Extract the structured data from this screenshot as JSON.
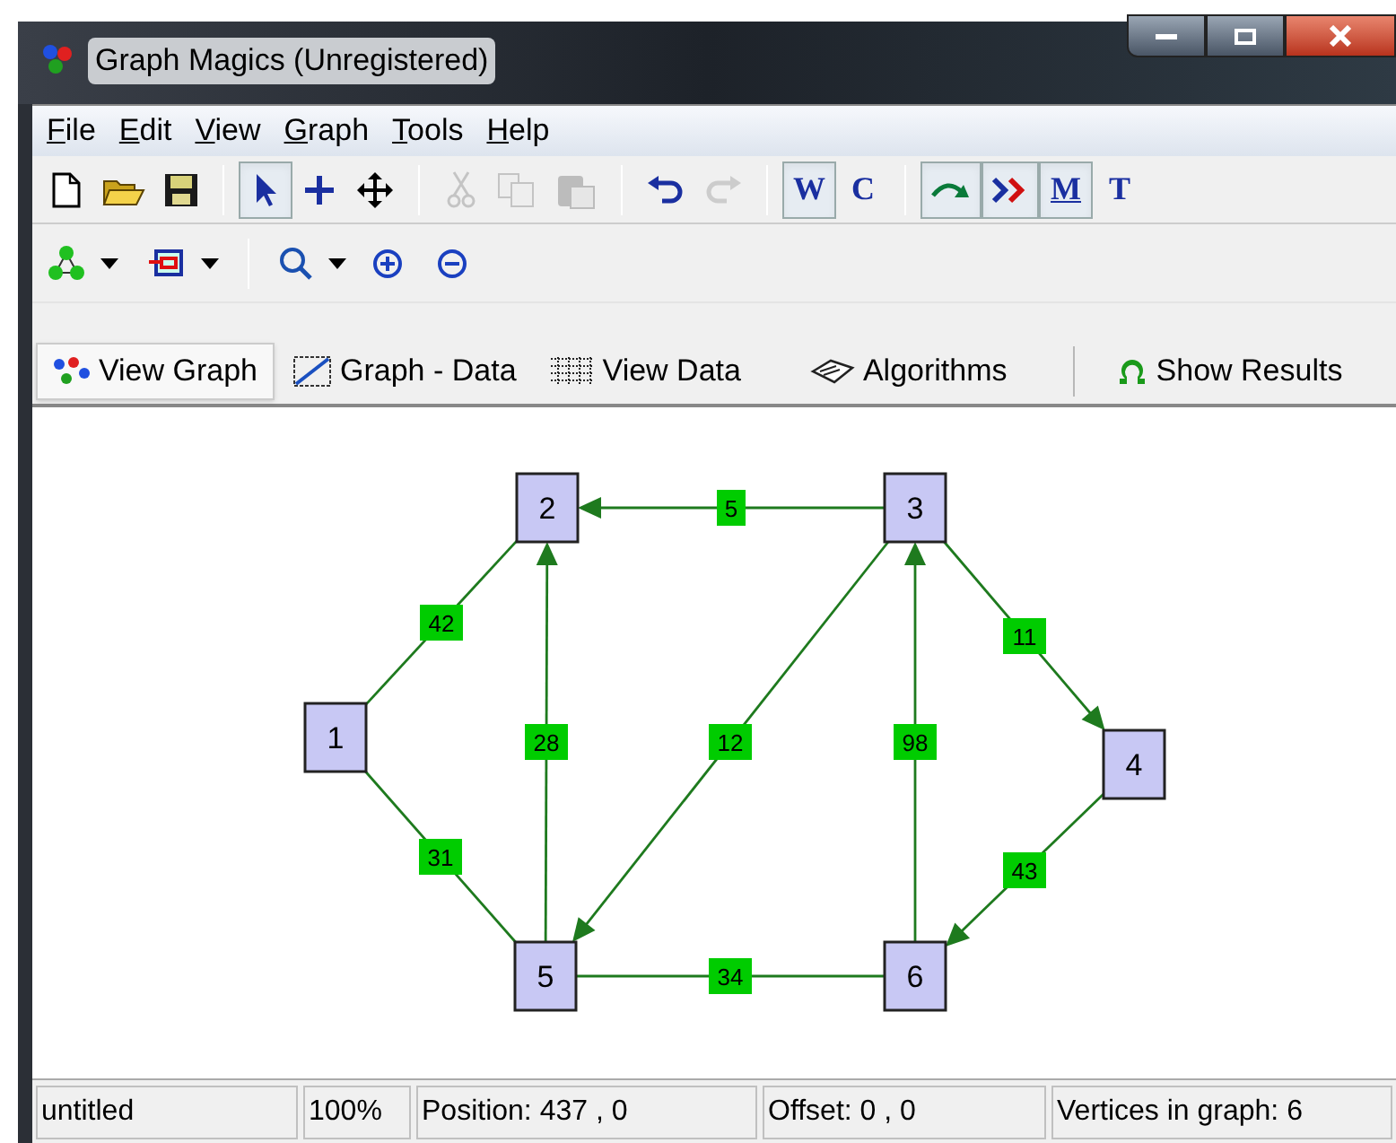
{
  "window": {
    "title": "Graph Magics (Unregistered)"
  },
  "menu": [
    {
      "label": "File"
    },
    {
      "label": "Edit"
    },
    {
      "label": "View"
    },
    {
      "label": "Graph"
    },
    {
      "label": "Tools"
    },
    {
      "label": "Help"
    }
  ],
  "toolbar": [
    [
      {
        "pressed": false,
        "disabled": false
      },
      {
        "pressed": false,
        "disabled": false
      },
      {
        "pressed": false,
        "disabled": false
      }
    ],
    [
      {
        "pressed": true,
        "disabled": false
      },
      {
        "pressed": false,
        "disabled": false
      },
      {
        "pressed": false,
        "disabled": false
      }
    ],
    [
      {
        "pressed": false,
        "disabled": true
      },
      {
        "pressed": false,
        "disabled": true
      },
      {
        "pressed": false,
        "disabled": true
      }
    ],
    [
      {
        "pressed": false,
        "disabled": false
      },
      {
        "pressed": false,
        "disabled": true
      }
    ],
    [
      {
        "pressed": true,
        "disabled": false,
        "label": "W"
      },
      {
        "pressed": false,
        "disabled": false,
        "label": "C"
      }
    ],
    [
      {
        "pressed": true,
        "disabled": false
      },
      {
        "pressed": true,
        "disabled": false
      },
      {
        "pressed": true,
        "disabled": false,
        "label": "M"
      },
      {
        "pressed": false,
        "disabled": false,
        "label": "T"
      }
    ]
  ],
  "tabs": [
    {
      "label": "View Graph",
      "selected": true
    },
    {
      "label": "Graph - Data",
      "selected": false
    },
    {
      "label": "View Data",
      "selected": false
    },
    {
      "label": "Algorithms",
      "selected": false
    },
    {
      "label": "Show Results",
      "selected": false
    }
  ],
  "graph": {
    "vertices": [
      "1",
      "2",
      "3",
      "4",
      "5",
      "6"
    ],
    "edges": [
      {
        "weight": "5",
        "directed": true
      },
      {
        "weight": "42",
        "directed": false
      },
      {
        "weight": "28",
        "directed": true
      },
      {
        "weight": "12",
        "directed": true
      },
      {
        "weight": "98",
        "directed": true
      },
      {
        "weight": "11",
        "directed": true
      },
      {
        "weight": "31",
        "directed": false
      },
      {
        "weight": "43",
        "directed": true
      },
      {
        "weight": "34",
        "directed": false
      }
    ]
  },
  "status_bar": [
    "untitled",
    "100%",
    "Position: 437 , 0",
    "Offset: 0 , 0",
    "Vertices in graph: 6"
  ]
}
